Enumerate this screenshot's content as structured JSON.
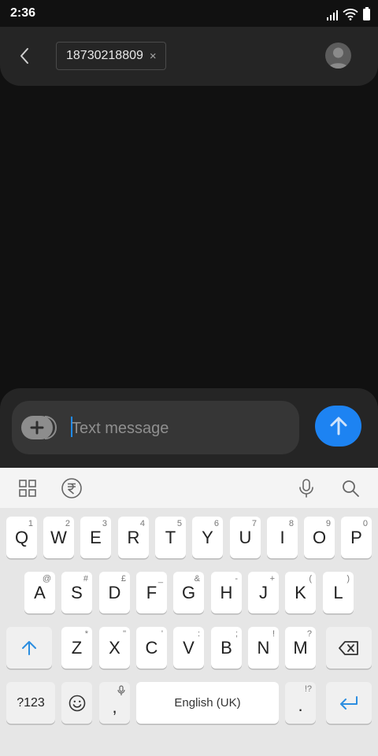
{
  "status_bar": {
    "time": "2:36"
  },
  "header": {
    "recipient": "18730218809",
    "chip_remove": "×"
  },
  "composer": {
    "placeholder": "Text message"
  },
  "keyboard": {
    "row1": [
      {
        "label": "Q",
        "hint": "1"
      },
      {
        "label": "W",
        "hint": "2"
      },
      {
        "label": "E",
        "hint": "3"
      },
      {
        "label": "R",
        "hint": "4"
      },
      {
        "label": "T",
        "hint": "5"
      },
      {
        "label": "Y",
        "hint": "6"
      },
      {
        "label": "U",
        "hint": "7"
      },
      {
        "label": "I",
        "hint": "8"
      },
      {
        "label": "O",
        "hint": "9"
      },
      {
        "label": "P",
        "hint": "0"
      }
    ],
    "row2": [
      {
        "label": "A",
        "hint": "@"
      },
      {
        "label": "S",
        "hint": "#"
      },
      {
        "label": "D",
        "hint": "£"
      },
      {
        "label": "F",
        "hint": "_"
      },
      {
        "label": "G",
        "hint": "&"
      },
      {
        "label": "H",
        "hint": "-"
      },
      {
        "label": "J",
        "hint": "+"
      },
      {
        "label": "K",
        "hint": "("
      },
      {
        "label": "L",
        "hint": ")"
      }
    ],
    "row3": [
      {
        "label": "Z",
        "hint": "*"
      },
      {
        "label": "X",
        "hint": "\""
      },
      {
        "label": "C",
        "hint": "'"
      },
      {
        "label": "V",
        "hint": ":"
      },
      {
        "label": "B",
        "hint": ";"
      },
      {
        "label": "N",
        "hint": "!"
      },
      {
        "label": "M",
        "hint": "?"
      }
    ],
    "symbols_label": "?123",
    "comma_label": ",",
    "space_label": "English (UK)",
    "period_label": ".",
    "period_hint": "!?"
  }
}
